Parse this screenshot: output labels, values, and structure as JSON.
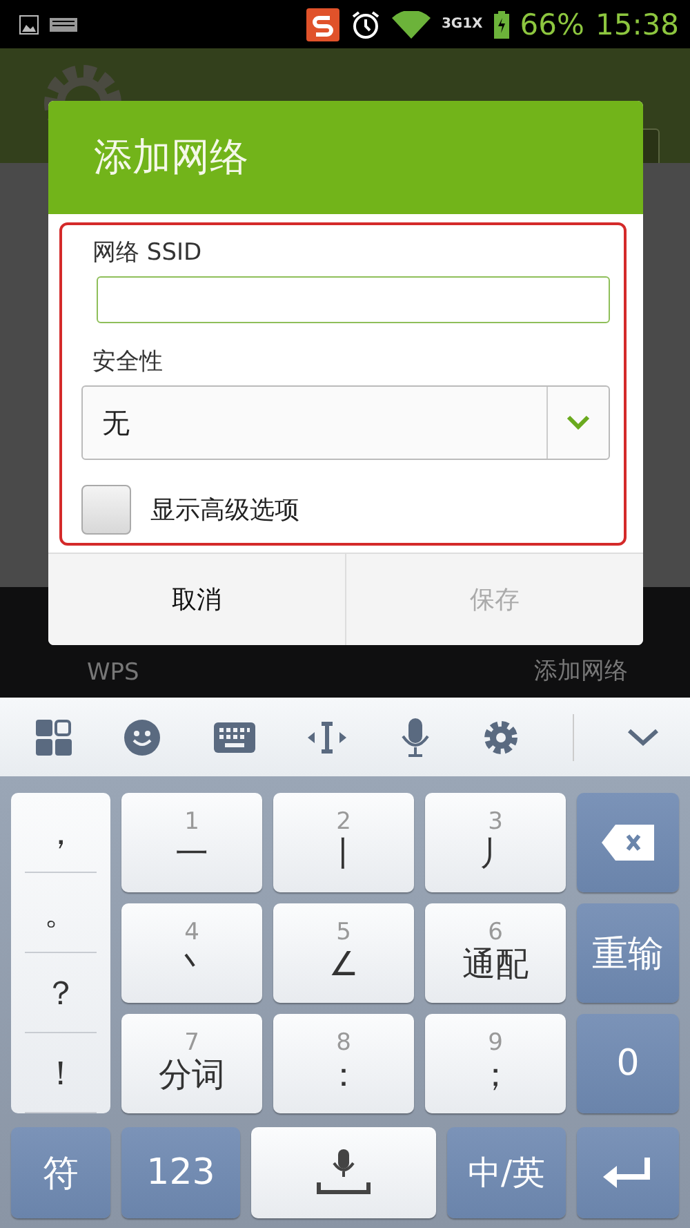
{
  "status_bar": {
    "network": "3G1X",
    "battery": "66%",
    "time": "15:38"
  },
  "header": {
    "toggle_on": false
  },
  "bottom_bar": [
    "WPS",
    "添加网络"
  ],
  "dialog": {
    "title": "添加网络",
    "ssid_label": "网络 SSID",
    "ssid_field": {
      "focused": true
    },
    "security_label": "安全性",
    "security_value": "无",
    "advanced_option": {
      "label": "显示高级选项",
      "checked": false
    },
    "buttons": [
      {
        "label": "取消",
        "disabled": false
      },
      {
        "label": "保存",
        "disabled": true
      }
    ]
  },
  "keyboard": {
    "punctuation": [
      "，",
      "。",
      "？",
      "！"
    ],
    "stroke_keys": [
      {
        "number": "1",
        "label": "一"
      },
      {
        "number": "2",
        "label": "丨"
      },
      {
        "number": "3",
        "label": "丿"
      },
      {
        "number": "4",
        "label": "丶"
      },
      {
        "number": "5",
        "label": "∠"
      },
      {
        "number": "6",
        "label": "通配"
      },
      {
        "number": "7",
        "label": "分词"
      },
      {
        "number": "8",
        "label": "："
      },
      {
        "number": "9",
        "label": "；"
      }
    ],
    "side_keys": [
      {
        "kind": "delete"
      },
      {
        "kind": "text",
        "label": "重输"
      },
      {
        "kind": "text",
        "label": "0"
      }
    ],
    "bottom_keys": [
      {
        "kind": "text",
        "label": "符"
      },
      {
        "kind": "text",
        "label": "123"
      },
      {
        "kind": "space"
      },
      {
        "kind": "text",
        "label": "中/英"
      },
      {
        "kind": "enter"
      }
    ]
  }
}
